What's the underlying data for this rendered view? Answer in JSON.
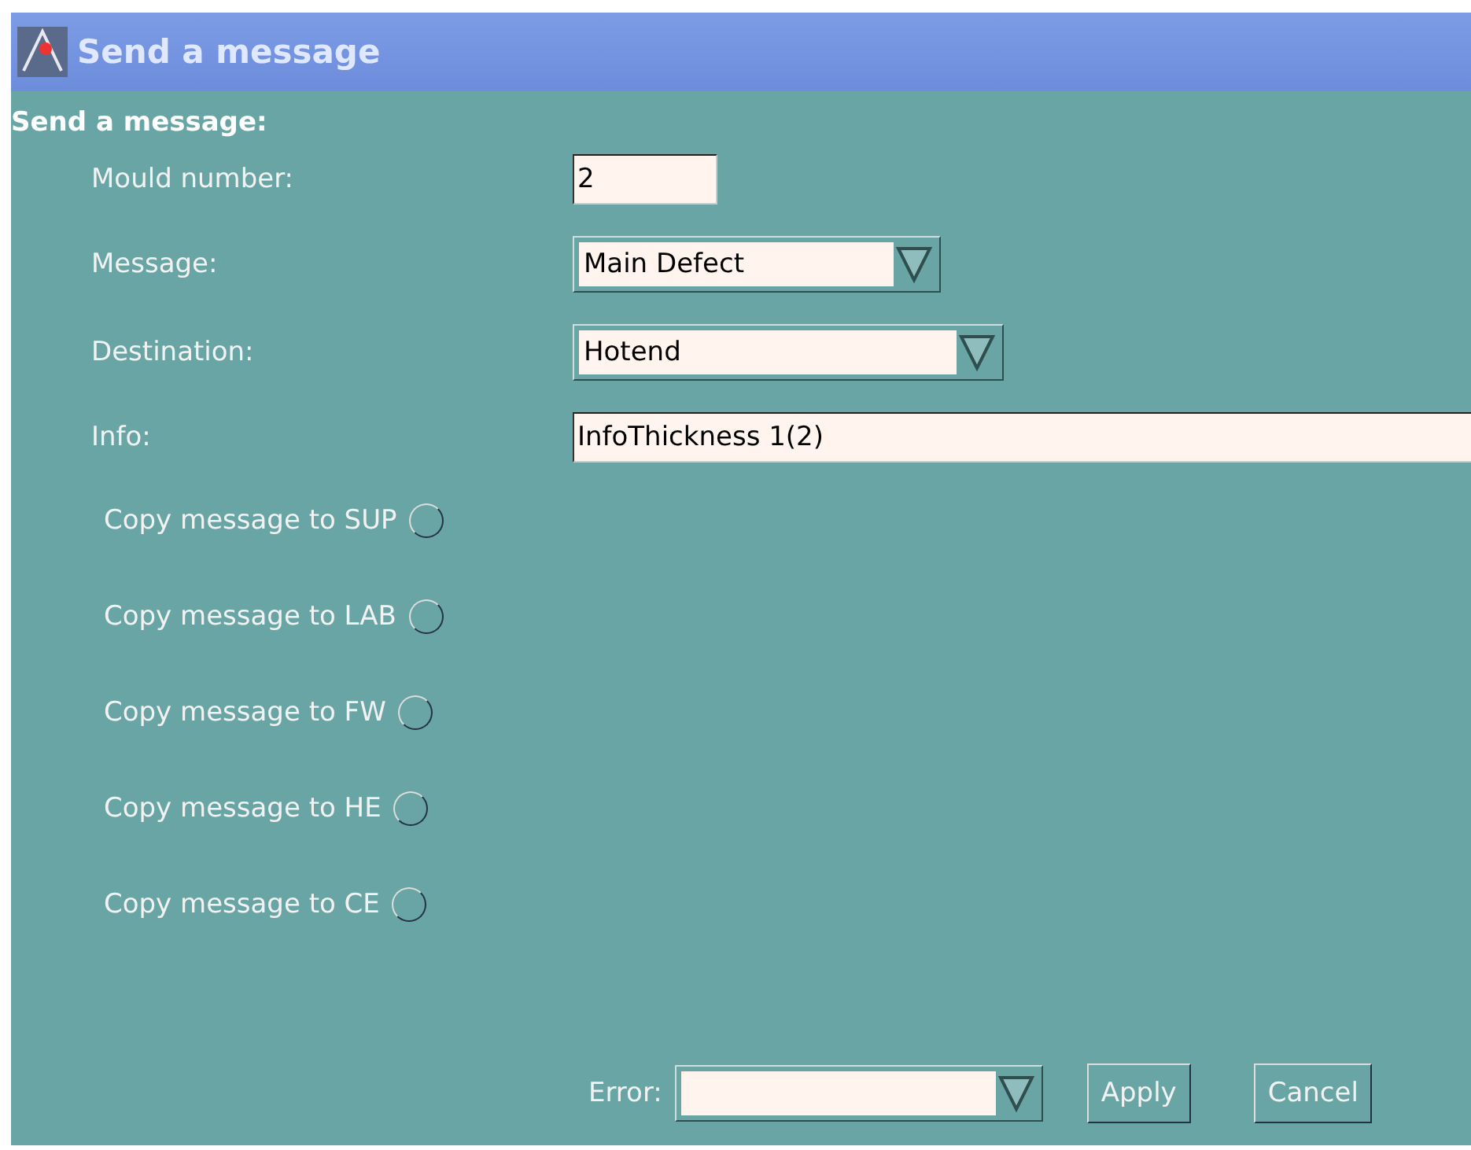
{
  "window": {
    "title": "Send a message"
  },
  "heading": "Send a message:",
  "fields": [
    {
      "kind": "text",
      "label": "Mould number:",
      "value": "2"
    },
    {
      "kind": "dropdown",
      "label": "Message:",
      "value": "Main Defect"
    },
    {
      "kind": "dropdown",
      "label": "Destination:",
      "value": "Hotend"
    },
    {
      "kind": "text",
      "label": "Info:",
      "value": "InfoThickness 1(2)"
    }
  ],
  "copy_options": [
    {
      "label": "Copy message to SUP",
      "checked": false
    },
    {
      "label": "Copy message to LAB",
      "checked": false
    },
    {
      "label": "Copy message to FW",
      "checked": false
    },
    {
      "label": "Copy message to HE",
      "checked": false
    },
    {
      "label": "Copy message to CE",
      "checked": false
    }
  ],
  "footer": {
    "error_label": "Error:",
    "buttons": [
      "Apply",
      "Cancel"
    ]
  }
}
